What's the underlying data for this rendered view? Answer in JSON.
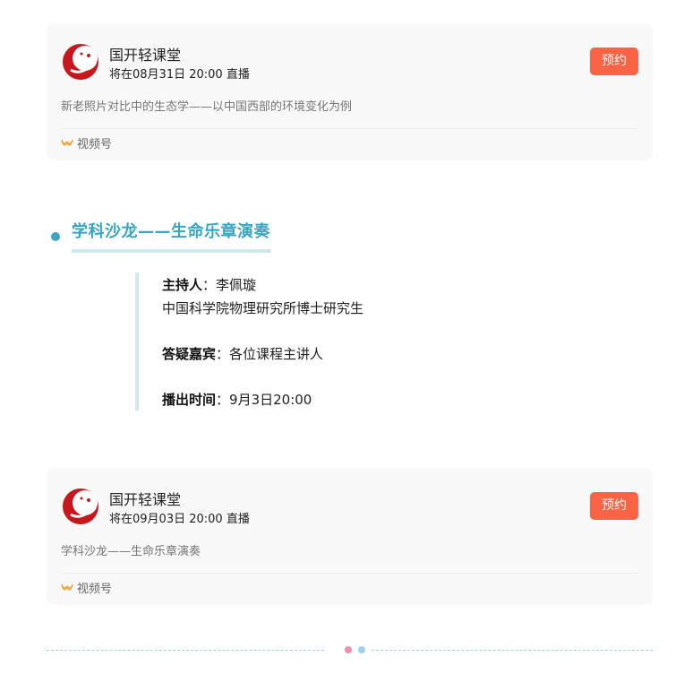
{
  "cards": [
    {
      "name": "国开轻课堂",
      "time": "将在08月31日 20:00 直播",
      "book_label": "预约",
      "desc": "新老照片对比中的生态学——以中国西部的环境变化为例",
      "platform": "视频号",
      "icon": "channels-icon"
    },
    {
      "name": "国开轻课堂",
      "time": "将在09月03日 20:00 直播",
      "book_label": "预约",
      "desc": "学科沙龙——生命乐章演奏",
      "platform": "视频号",
      "icon": "channels-icon"
    }
  ],
  "section": {
    "title": "学科沙龙——生命乐章演奏",
    "host_label": "主持人",
    "host_sep": "：",
    "host_value": "李佩璇",
    "host_title": "中国科学院物理研究所博士研究生",
    "guest_label": "答疑嘉宾",
    "guest_sep": "：",
    "guest_value": "各位课程主讲人",
    "air_label": "播出时间",
    "air_sep": "：",
    "air_value": "9月3日20:00"
  },
  "colors": {
    "accent": "#3aa6c2",
    "book_button": "#fa6444",
    "card_bg": "#f8f8f8",
    "dot_pink": "#f58cad",
    "dot_blue": "#9fd0ea"
  }
}
